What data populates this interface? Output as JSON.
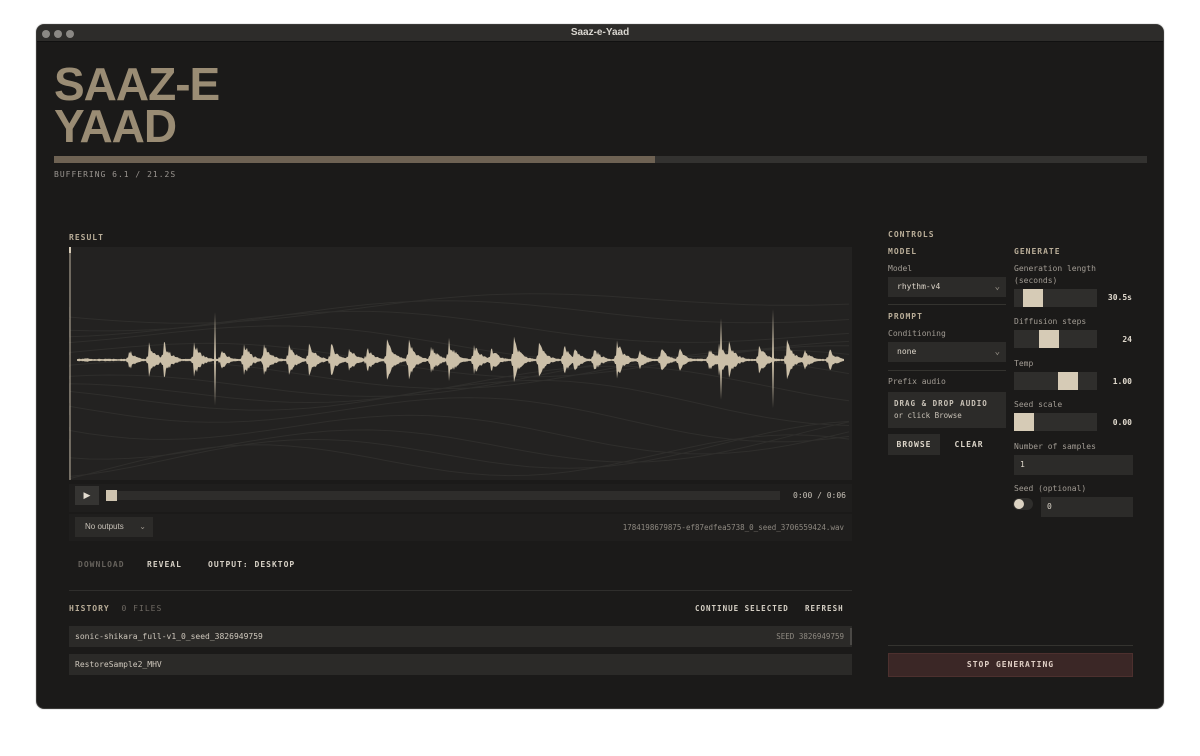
{
  "window": {
    "title": "Saaz-e-Yaad"
  },
  "app": {
    "logo_line1": "SAAZ-E",
    "logo_line2": "YAAD",
    "buffering_text": "BUFFERING 6.1 / 21.2S",
    "buffer_progress": 0.55
  },
  "result": {
    "label": "RESULT",
    "play_icon": "play-icon",
    "time": "0:00 / 0:06",
    "playhead_fraction": 0.0,
    "outputs_select": "No outputs",
    "filename": "1784198679875-ef87edfea5738_0_seed_3706559424.wav",
    "actions": {
      "download": "DOWNLOAD",
      "reveal": "REVEAL",
      "output": "OUTPUT: DESKTOP"
    }
  },
  "history": {
    "label": "HISTORY",
    "count": "0 FILES",
    "continue_selected": "CONTINUE SELECTED",
    "refresh": "REFRESH",
    "items": [
      {
        "name": "sonic-shikara_full-v1_0_seed_3826949759",
        "seed": "SEED 3826949759"
      },
      {
        "name": "RestoreSample2_MHV",
        "seed": ""
      }
    ]
  },
  "controls": {
    "title": "CONTROLS",
    "model": {
      "section": "MODEL",
      "label": "Model",
      "value": "rhythm-v4"
    },
    "prompt": {
      "section": "PROMPT",
      "conditioning_label": "Conditioning",
      "conditioning_value": "none",
      "prefix_label": "Prefix audio",
      "drop_line1": "DRAG & DROP AUDIO",
      "drop_line2": "or click Browse",
      "browse": "BROWSE",
      "clear": "CLEAR"
    },
    "generate": {
      "section": "GENERATE",
      "gen_length_label": "Generation length (seconds)",
      "gen_length_value": "30.5s",
      "gen_length_level": 0.15,
      "diffusion_label": "Diffusion steps",
      "diffusion_value": "24",
      "diffusion_level": 0.4,
      "temp_label": "Temp",
      "temp_value": "1.00",
      "temp_level": 0.7,
      "seed_scale_label": "Seed scale",
      "seed_scale_value": "0.00",
      "seed_scale_level": 0.0,
      "num_samples_label": "Number of samples",
      "num_samples_value": "1",
      "seed_label": "Seed (optional)",
      "seed_value": "0"
    },
    "stop": "STOP GENERATING"
  },
  "colors": {
    "background": "#1b1a19",
    "accent": "#9a8c74",
    "waveform": "#cbbfa8",
    "stop_button": "#3b2726"
  }
}
